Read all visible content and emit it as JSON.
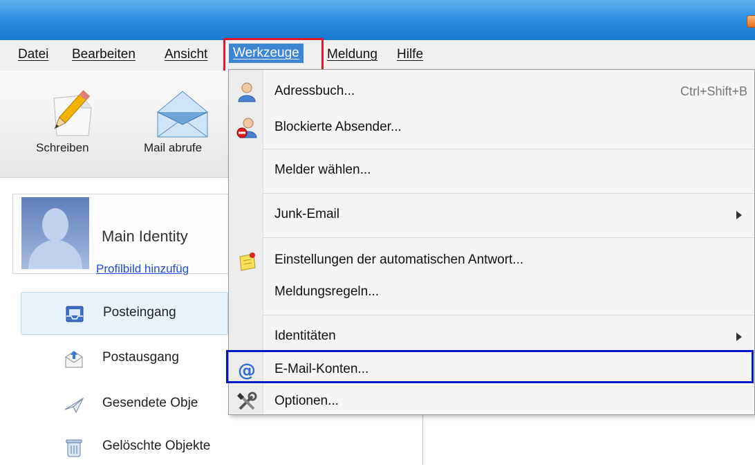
{
  "menubar": {
    "items": [
      "Datei",
      "Bearbeiten",
      "Ansicht",
      "Werkzeuge",
      "Meldung",
      "Hilfe"
    ]
  },
  "toolbar": {
    "compose_label": "Schreiben",
    "get_mail_label": "Mail abrufe"
  },
  "identity": {
    "name": "Main Identity",
    "add_picture_link": "Profilbild hinzufüg"
  },
  "folders": [
    {
      "label": "Posteingang",
      "icon": "inbox-icon"
    },
    {
      "label": "Postausgang",
      "icon": "outbox-icon"
    },
    {
      "label": "Gesendete Obje",
      "icon": "sent-icon"
    },
    {
      "label": "Gelöschte Objekte",
      "icon": "trash-icon"
    }
  ],
  "dropdown": {
    "items": [
      {
        "label": "Adressbuch...",
        "shortcut": "Ctrl+Shift+B",
        "icon": "addressbook-icon"
      },
      {
        "label": "Blockierte Absender...",
        "icon": "blocked-senders-icon"
      },
      {
        "label": "Melder wählen...",
        "icon": ""
      },
      {
        "label": "Junk-Email",
        "icon": "",
        "submenu": true
      },
      {
        "label": "Einstellungen der automatischen Antwort...",
        "icon": "autoreply-icon"
      },
      {
        "label": "Meldungsregeln...",
        "icon": ""
      },
      {
        "label": "Identitäten",
        "icon": "",
        "submenu": true
      },
      {
        "label": "E-Mail-Konten...",
        "icon": "at-sign-icon"
      },
      {
        "label": "Optionen...",
        "icon": "tools-icon"
      }
    ]
  },
  "colors": {
    "highlight_red": "#e2182a",
    "highlight_blue": "#0018c8",
    "menu_active": "#3d86d6"
  }
}
